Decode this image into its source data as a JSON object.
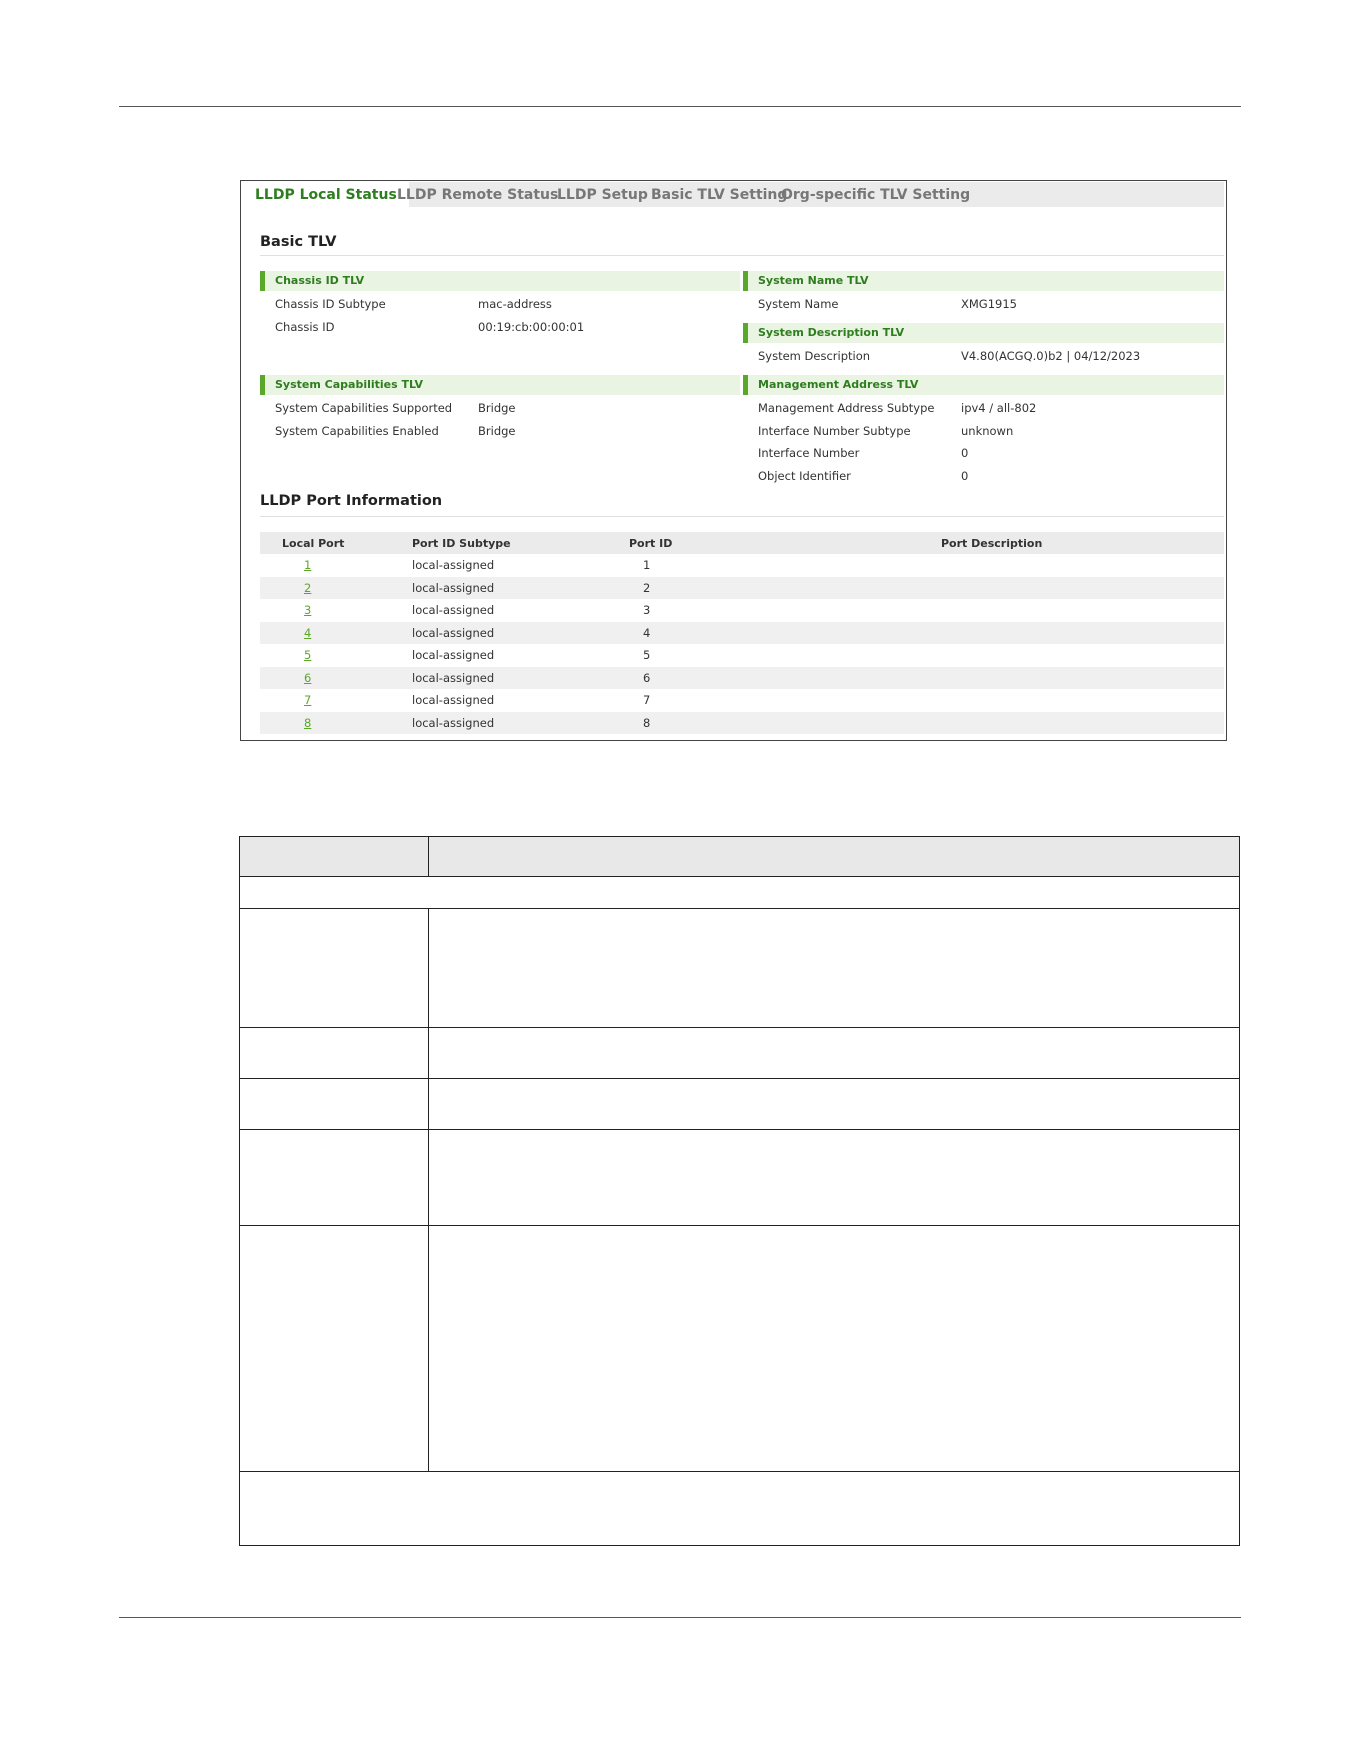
{
  "tabs": [
    {
      "label": "LLDP Local Status",
      "active": true
    },
    {
      "label": "LLDP Remote Status",
      "active": false
    },
    {
      "label": "LLDP Setup",
      "active": false
    },
    {
      "label": "Basic TLV Setting",
      "active": false
    },
    {
      "label": "Org-specific TLV Setting",
      "active": false
    }
  ],
  "basic_tlv": {
    "title": "Basic TLV",
    "chassis": {
      "heading": "Chassis ID TLV",
      "subtype_label": "Chassis ID Subtype",
      "subtype_value": "mac-address",
      "id_label": "Chassis ID",
      "id_value": "00:19:cb:00:00:01"
    },
    "system_name": {
      "heading": "System Name TLV",
      "label": "System Name",
      "value": "XMG1915"
    },
    "system_description": {
      "heading": "System Description TLV",
      "label": "System Description",
      "value": "V4.80(ACGQ.0)b2 | 04/12/2023"
    },
    "system_capabilities": {
      "heading": "System Capabilities TLV",
      "supported_label": "System Capabilities Supported",
      "supported_value": "Bridge",
      "enabled_label": "System Capabilities Enabled",
      "enabled_value": "Bridge"
    },
    "management_address": {
      "heading": "Management Address TLV",
      "rows": [
        {
          "label": "Management Address Subtype",
          "value": "ipv4 / all-802"
        },
        {
          "label": "Interface Number Subtype",
          "value": "unknown"
        },
        {
          "label": "Interface Number",
          "value": "0"
        },
        {
          "label": "Object Identifier",
          "value": "0"
        }
      ]
    }
  },
  "port_info": {
    "title": "LLDP Port Information",
    "columns": [
      "Local Port",
      "Port ID Subtype",
      "Port ID",
      "Port Description"
    ],
    "rows": [
      {
        "local_port": "1",
        "subtype": "local-assigned",
        "port_id": "1",
        "description": ""
      },
      {
        "local_port": "2",
        "subtype": "local-assigned",
        "port_id": "2",
        "description": ""
      },
      {
        "local_port": "3",
        "subtype": "local-assigned",
        "port_id": "3",
        "description": ""
      },
      {
        "local_port": "4",
        "subtype": "local-assigned",
        "port_id": "4",
        "description": ""
      },
      {
        "local_port": "5",
        "subtype": "local-assigned",
        "port_id": "5",
        "description": ""
      },
      {
        "local_port": "6",
        "subtype": "local-assigned",
        "port_id": "6",
        "description": ""
      },
      {
        "local_port": "7",
        "subtype": "local-assigned",
        "port_id": "7",
        "description": ""
      },
      {
        "local_port": "8",
        "subtype": "local-assigned",
        "port_id": "8",
        "description": ""
      }
    ]
  },
  "colors": {
    "accent_green": "#5aa82a",
    "heading_green": "#2e7d1f",
    "tlv_band": "#eaf4e2"
  }
}
